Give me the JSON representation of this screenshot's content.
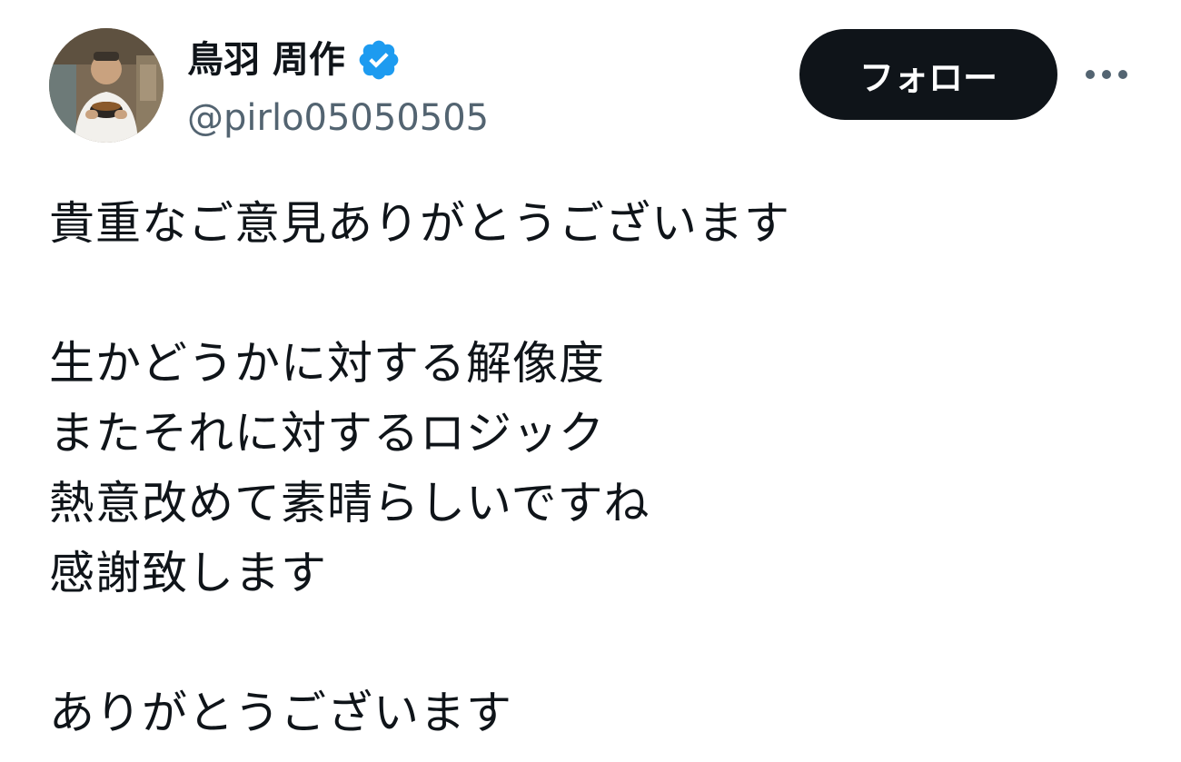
{
  "author": {
    "display_name": "鳥羽 周作",
    "handle": "@pirlo05050505",
    "verified": true,
    "avatar_icon": "profile-photo-man-holding-bowl"
  },
  "actions": {
    "follow_label": "フォロー",
    "more_icon": "more-horizontal-icon"
  },
  "tweet": {
    "lines": [
      "貴重なご意見ありがとうございます",
      "",
      "生かどうかに対する解像度",
      "またそれに対するロジック",
      "熱意改めて素晴らしいですね",
      "感謝致します",
      "",
      "ありがとうございます"
    ]
  },
  "colors": {
    "verified_badge": "#1d9bf0",
    "follow_button_bg": "#0f1419",
    "handle_text": "#536471"
  }
}
